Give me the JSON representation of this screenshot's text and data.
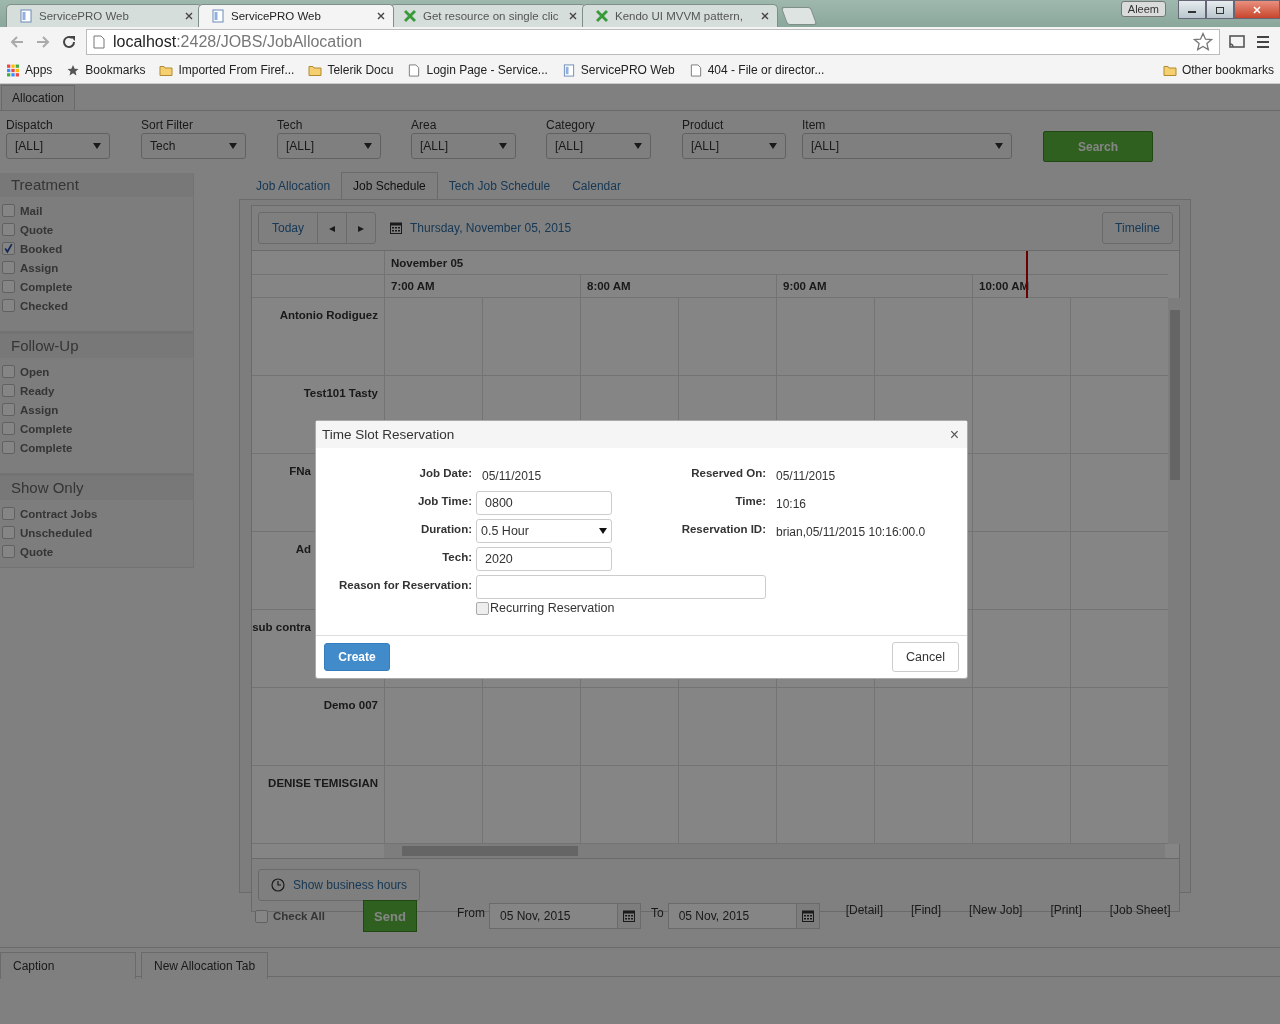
{
  "browser": {
    "tabs": [
      {
        "title": "ServicePRO Web",
        "kind": "page",
        "selected": false
      },
      {
        "title": "ServicePRO Web",
        "kind": "page",
        "selected": true
      },
      {
        "title": "Get resource on single clic",
        "kind": "kendo",
        "selected": false
      },
      {
        "title": "Kendo UI MVVM pattern,",
        "kind": "kendo",
        "selected": false
      }
    ],
    "user": "Aleem",
    "address": {
      "host": "localhost",
      "path": ":2428/JOBS/JobAllocation"
    },
    "bookmarks": [
      {
        "label": "Apps",
        "kind": "apps"
      },
      {
        "label": "Bookmarks",
        "kind": "star"
      },
      {
        "label": "Imported From Firef...",
        "kind": "folder"
      },
      {
        "label": "Telerik Docu",
        "kind": "folder"
      },
      {
        "label": "Login Page - Service...",
        "kind": "doc"
      },
      {
        "label": "ServicePRO Web",
        "kind": "page"
      },
      {
        "label": "404 - File or director...",
        "kind": "doc"
      }
    ],
    "other_bookmarks": "Other bookmarks"
  },
  "page_tab": "Allocation",
  "filters": [
    {
      "label": "Dispatch",
      "value": "[ALL]"
    },
    {
      "label": "Sort Filter",
      "value": "Tech"
    },
    {
      "label": "Tech",
      "value": "[ALL]"
    },
    {
      "label": "Area",
      "value": "[ALL]"
    },
    {
      "label": "Category",
      "value": "[ALL]"
    },
    {
      "label": "Product",
      "value": "[ALL]"
    },
    {
      "label": "Item",
      "value": "[ALL]"
    }
  ],
  "search_button": "Search",
  "sidebar": [
    {
      "title": "Treatment",
      "items": [
        {
          "label": "Mail",
          "checked": false
        },
        {
          "label": "Quote",
          "checked": false
        },
        {
          "label": "Booked",
          "checked": true
        },
        {
          "label": "Assign",
          "checked": false
        },
        {
          "label": "Complete",
          "checked": false
        },
        {
          "label": "Checked",
          "checked": false
        }
      ]
    },
    {
      "title": "Follow-Up",
      "items": [
        {
          "label": "Open",
          "checked": false
        },
        {
          "label": "Ready",
          "checked": false
        },
        {
          "label": "Assign",
          "checked": false
        },
        {
          "label": "Complete",
          "checked": false
        },
        {
          "label": "Complete",
          "checked": false
        }
      ]
    },
    {
      "title": "Show Only",
      "items": [
        {
          "label": "Contract Jobs",
          "checked": false
        },
        {
          "label": "Unscheduled",
          "checked": false
        },
        {
          "label": "Quote",
          "checked": false
        }
      ]
    }
  ],
  "view_tabs": [
    {
      "label": "Job Allocation",
      "selected": false
    },
    {
      "label": "Job Schedule",
      "selected": true
    },
    {
      "label": "Tech Job Schedule",
      "selected": false
    },
    {
      "label": "Calendar",
      "selected": false
    }
  ],
  "scheduler": {
    "today": "Today",
    "prev": "◂",
    "next": "▸",
    "date": "Thursday, November 05, 2015",
    "view_button": "Timeline",
    "day": "November 05",
    "times": [
      "7:00 AM",
      "8:00 AM",
      "9:00 AM",
      "10:00 AM"
    ],
    "resources": [
      {
        "name": "Antonio Rodiguez",
        "partly_hidden": false
      },
      {
        "name": "Test101 Tasty",
        "partly_hidden": false
      },
      {
        "name": "FNa",
        "partly_hidden": true
      },
      {
        "name": "Ad",
        "partly_hidden": true
      },
      {
        "name": "sub contra",
        "partly_hidden": true
      },
      {
        "name": "Demo 007",
        "partly_hidden": false
      },
      {
        "name": "DENISE TEMISGIAN",
        "partly_hidden": false
      }
    ],
    "business_hours": "Show business hours"
  },
  "footer": {
    "check_all": {
      "label": "Check All",
      "checked": false
    },
    "send": "Send",
    "from": {
      "label": "From",
      "value": "05 Nov, 2015"
    },
    "to": {
      "label": "To",
      "value": "05 Nov, 2015"
    },
    "links": [
      "[Detail]",
      "[Find]",
      "[New Job]",
      "[Print]",
      "[Job Sheet]"
    ]
  },
  "bottom_tabs": [
    "Caption",
    "New Allocation Tab"
  ],
  "dialog": {
    "title": "Time Slot Reservation",
    "close": "×",
    "rows": [
      {
        "label": "Job Date:",
        "kind": "text",
        "value": "05/11/2015",
        "right_label": "Reserved On:",
        "right_value": "05/11/2015"
      },
      {
        "label": "Job Time:",
        "kind": "input",
        "value": "0800",
        "right_label": "Time:",
        "right_value": "10:16"
      },
      {
        "label": "Duration:",
        "kind": "select",
        "value": "0.5 Hour",
        "right_label": "Reservation ID:",
        "right_value": "brian,05/11/2015 10:16:00.0"
      },
      {
        "label": "Tech:",
        "kind": "input",
        "value": "2020"
      }
    ],
    "reason_label": "Reason for Reservation:",
    "recurring": {
      "label": "Recurring Reservation",
      "checked": false
    },
    "create": "Create",
    "cancel": "Cancel"
  }
}
